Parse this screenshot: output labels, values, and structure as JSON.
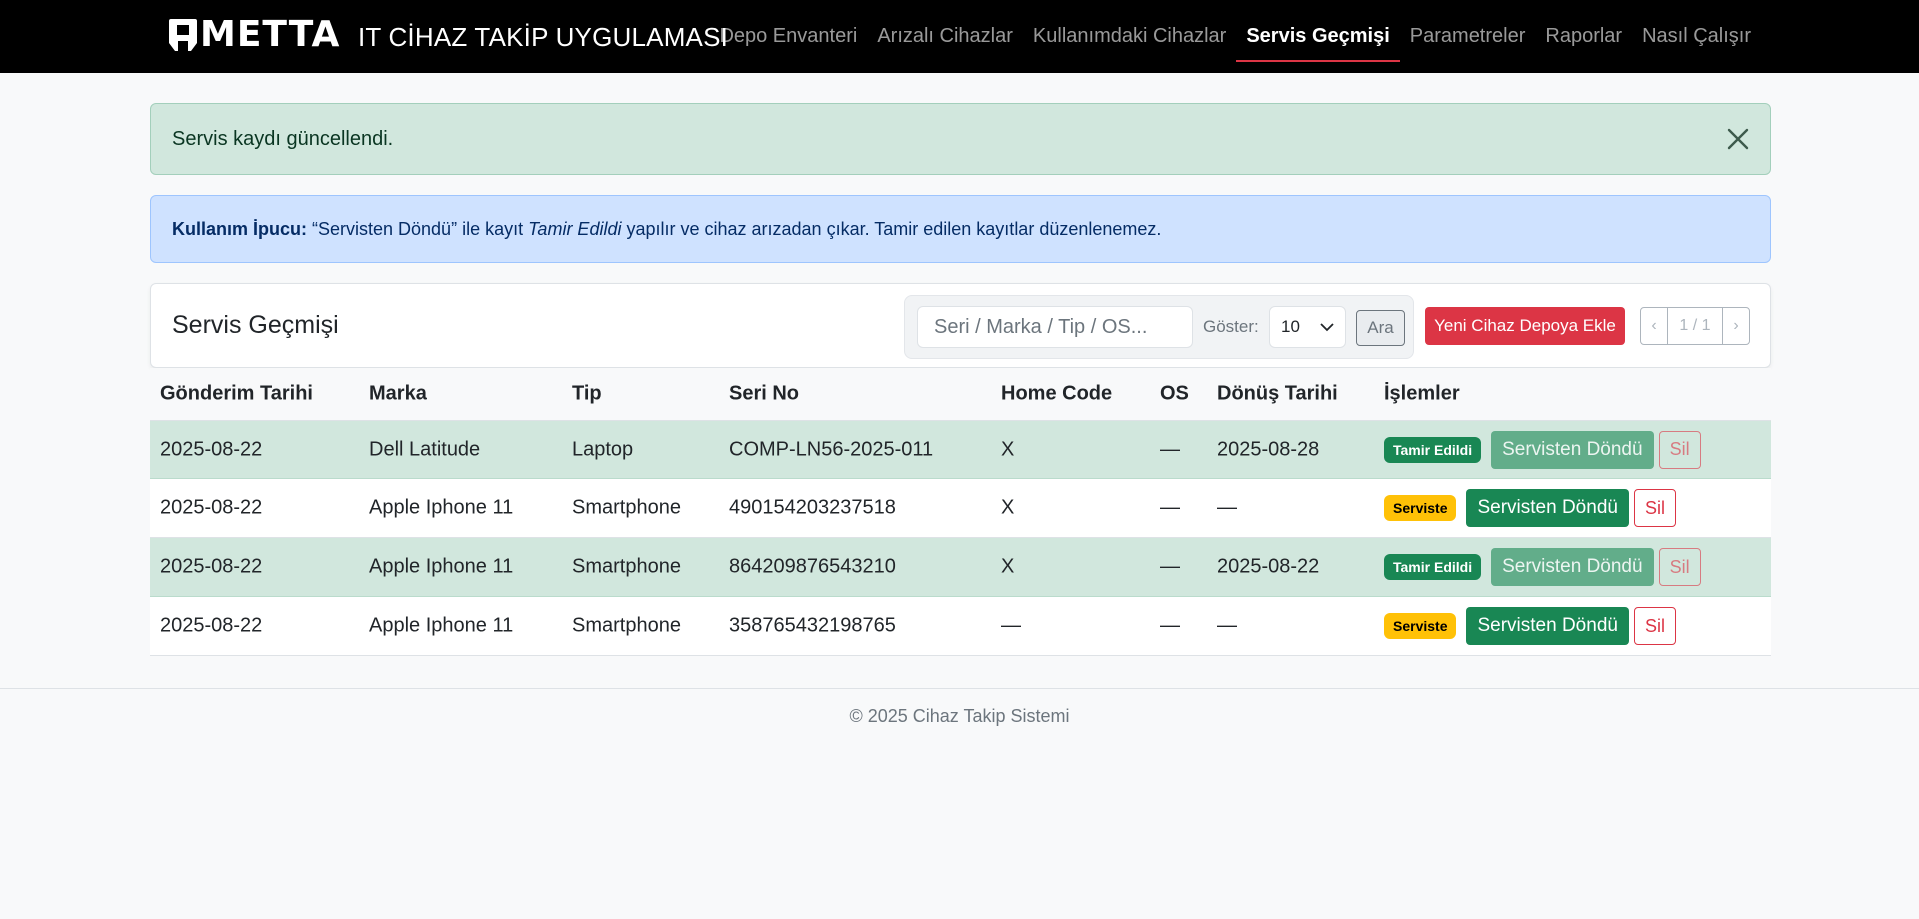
{
  "brand": {
    "logo_text": "METTA",
    "app_title": "IT CİHAZ TAKİP UYGULAMASI"
  },
  "nav": [
    {
      "label": "Depo Envanteri",
      "active": false
    },
    {
      "label": "Arızalı Cihazlar",
      "active": false
    },
    {
      "label": "Kullanımdaki Cihazlar",
      "active": false
    },
    {
      "label": "Servis Geçmişi",
      "active": true
    },
    {
      "label": "Parametreler",
      "active": false
    },
    {
      "label": "Raporlar",
      "active": false
    },
    {
      "label": "Nasıl Çalışır",
      "active": false
    }
  ],
  "alerts": {
    "success": "Servis kaydı güncellendi.",
    "tip_label": "Kullanım İpucu:",
    "tip_part1": "“Servisten Döndü” ile kayıt",
    "tip_italic": "Tamir Edildi",
    "tip_part2": "yapılır ve cihaz arızadan çıkar. Tamir edilen kayıtlar düzenlenemez."
  },
  "card": {
    "title": "Servis Geçmişi",
    "search_placeholder": "Seri / Marka / Tip / OS...",
    "show_label": "Göster:",
    "show_value": "10",
    "search_button": "Ara",
    "add_button": "Yeni Cihaz Depoya Ekle",
    "pager": {
      "prev": "‹",
      "info": "1 / 1",
      "next": "›"
    }
  },
  "table": {
    "headers": [
      "Gönderim Tarihi",
      "Marka",
      "Tip",
      "Seri No",
      "Home Code",
      "OS",
      "Dönüş Tarihi",
      "İşlemler"
    ],
    "rows": [
      {
        "sent": "2025-08-22",
        "brand": "Dell Latitude",
        "type": "Laptop",
        "serial": "COMP-LN56-2025-011",
        "home_code": "X",
        "os": "—",
        "return_date": "2025-08-28",
        "status": "Tamir Edildi",
        "return_btn": "Servisten Döndü",
        "delete_btn": "Sil"
      },
      {
        "sent": "2025-08-22",
        "brand": "Apple Iphone 11",
        "type": "Smartphone",
        "serial": "490154203237518",
        "home_code": "X",
        "os": "—",
        "return_date": "—",
        "status": "Serviste",
        "return_btn": "Servisten Döndü",
        "delete_btn": "Sil"
      },
      {
        "sent": "2025-08-22",
        "brand": "Apple Iphone 11",
        "type": "Smartphone",
        "serial": "864209876543210",
        "home_code": "X",
        "os": "—",
        "return_date": "2025-08-22",
        "status": "Tamir Edildi",
        "return_btn": "Servisten Döndü",
        "delete_btn": "Sil"
      },
      {
        "sent": "2025-08-22",
        "brand": "Apple Iphone 11",
        "type": "Smartphone",
        "serial": "358765432198765",
        "home_code": "—",
        "os": "—",
        "return_date": "—",
        "status": "Serviste",
        "return_btn": "Servisten Döndü",
        "delete_btn": "Sil"
      }
    ]
  },
  "footer": "© 2025 Cihaz Takip Sistemi",
  "colors": {
    "navbar": "#000000",
    "danger": "#dc3545",
    "success": "#198754",
    "warning": "#ffc107"
  }
}
